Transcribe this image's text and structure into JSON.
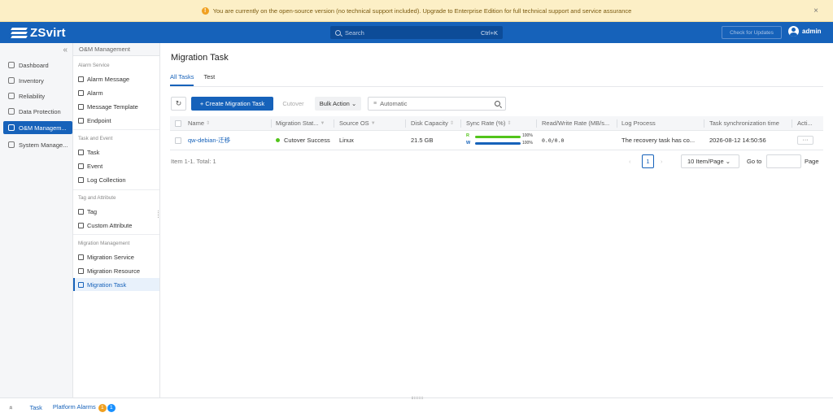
{
  "banner": {
    "text": "You are currently on the open-source version (no technical support included). Upgrade to Enterprise Edition for full technical support and service assurance",
    "warn_icon": "!",
    "close": "×"
  },
  "topbar": {
    "logo_text": "ZSvirt",
    "search_placeholder": "Search",
    "search_shortcut": "Ctrl+K",
    "check_updates": "Check for Updates",
    "user": "admin",
    "color": "#1662ba"
  },
  "nav1": {
    "collapse": "«",
    "items": [
      {
        "label": "Dashboard",
        "icon": "dashboard-icon"
      },
      {
        "label": "Inventory",
        "icon": "inventory-icon"
      },
      {
        "label": "Reliability",
        "icon": "reliability-icon"
      },
      {
        "label": "Data Protection",
        "icon": "data-protection-icon"
      },
      {
        "label": "O&M Managem...",
        "icon": "om-management-icon",
        "active": true
      },
      {
        "label": "System Manage...",
        "icon": "system-management-icon"
      }
    ]
  },
  "nav2": {
    "title": "O&M Management",
    "groups": [
      {
        "title": "Alarm Service",
        "links": [
          "Alarm Message",
          "Alarm",
          "Message Template",
          "Endpoint"
        ]
      },
      {
        "title": "Task and Event",
        "links": [
          "Task",
          "Event",
          "Log Collection"
        ]
      },
      {
        "title": "Tag and Attribute",
        "links": [
          "Tag",
          "Custom Attribute"
        ]
      },
      {
        "title": "Migration Management",
        "links": [
          "Migration Service",
          "Migration Resource",
          "Migration Task"
        ]
      }
    ],
    "active_link": "Migration Task"
  },
  "main": {
    "title": "Migration Task",
    "tabs": [
      "All Tasks",
      "Test"
    ],
    "active_tab": "All Tasks",
    "toolbar": {
      "refresh": "↻",
      "create": "+ Create Migration Task",
      "cutover": "Cutover",
      "bulk_action": "Bulk Action ⌄",
      "filter_icon": "≡",
      "filter_value": "Automatic"
    },
    "columns": [
      "Name",
      "Migration Stat...",
      "Source OS",
      "Disk Capacity",
      "Sync Rate (%)",
      "Read/Write Rate (MB/s...",
      "Log Process",
      "Task synchronization time",
      "Acti..."
    ],
    "sort_glyph": "⇕",
    "filter_glyph": "▼",
    "rows": [
      {
        "name": "qw-debian-迁移",
        "status": "Cutover Success",
        "status_color": "#52c41a",
        "source_os": "Linux",
        "disk_capacity": "21.5 GB",
        "sync": {
          "r_label": "R",
          "w_label": "W",
          "r_pct": "100%",
          "w_pct": "100%",
          "r_value": 100,
          "w_value": 100,
          "r_color": "#52c41a",
          "w_color": "#1662ba"
        },
        "rw_rate": "0.0/0.0",
        "log_process": "The recovery task has co...",
        "sync_time": "2026-08-12 14:50:56",
        "action": "···"
      }
    ],
    "footer": {
      "info": "Item 1-1. Total: 1",
      "prev": "‹",
      "current_page": "1",
      "next": "›",
      "page_size": "10 Item/Page ⌄",
      "goto": "Go to",
      "page": "Page"
    }
  },
  "bottom": {
    "expand": "»",
    "task": "Task",
    "platform_alarms": "Platform Alarms",
    "badge_1": "1",
    "badge_2": "1"
  }
}
